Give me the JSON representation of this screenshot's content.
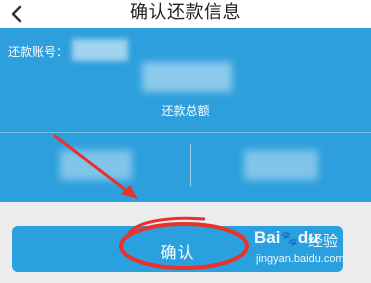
{
  "header": {
    "title": "确认还款信息",
    "back_icon": "chevron-left-icon"
  },
  "account": {
    "label": "还款账号："
  },
  "summary": {
    "amount_label": "还款总额"
  },
  "confirm": {
    "label": "确认"
  },
  "watermark": {
    "logo": "Bai",
    "logo_suffix": "du",
    "text": "经验",
    "url": "jingyan.baidu.com"
  },
  "annotations": {
    "arrow_color": "#e8322b",
    "circle_color": "#e8322b"
  },
  "colors": {
    "accent": "#2d9fdc",
    "button": "#2aa1de",
    "background": "#ececec"
  }
}
